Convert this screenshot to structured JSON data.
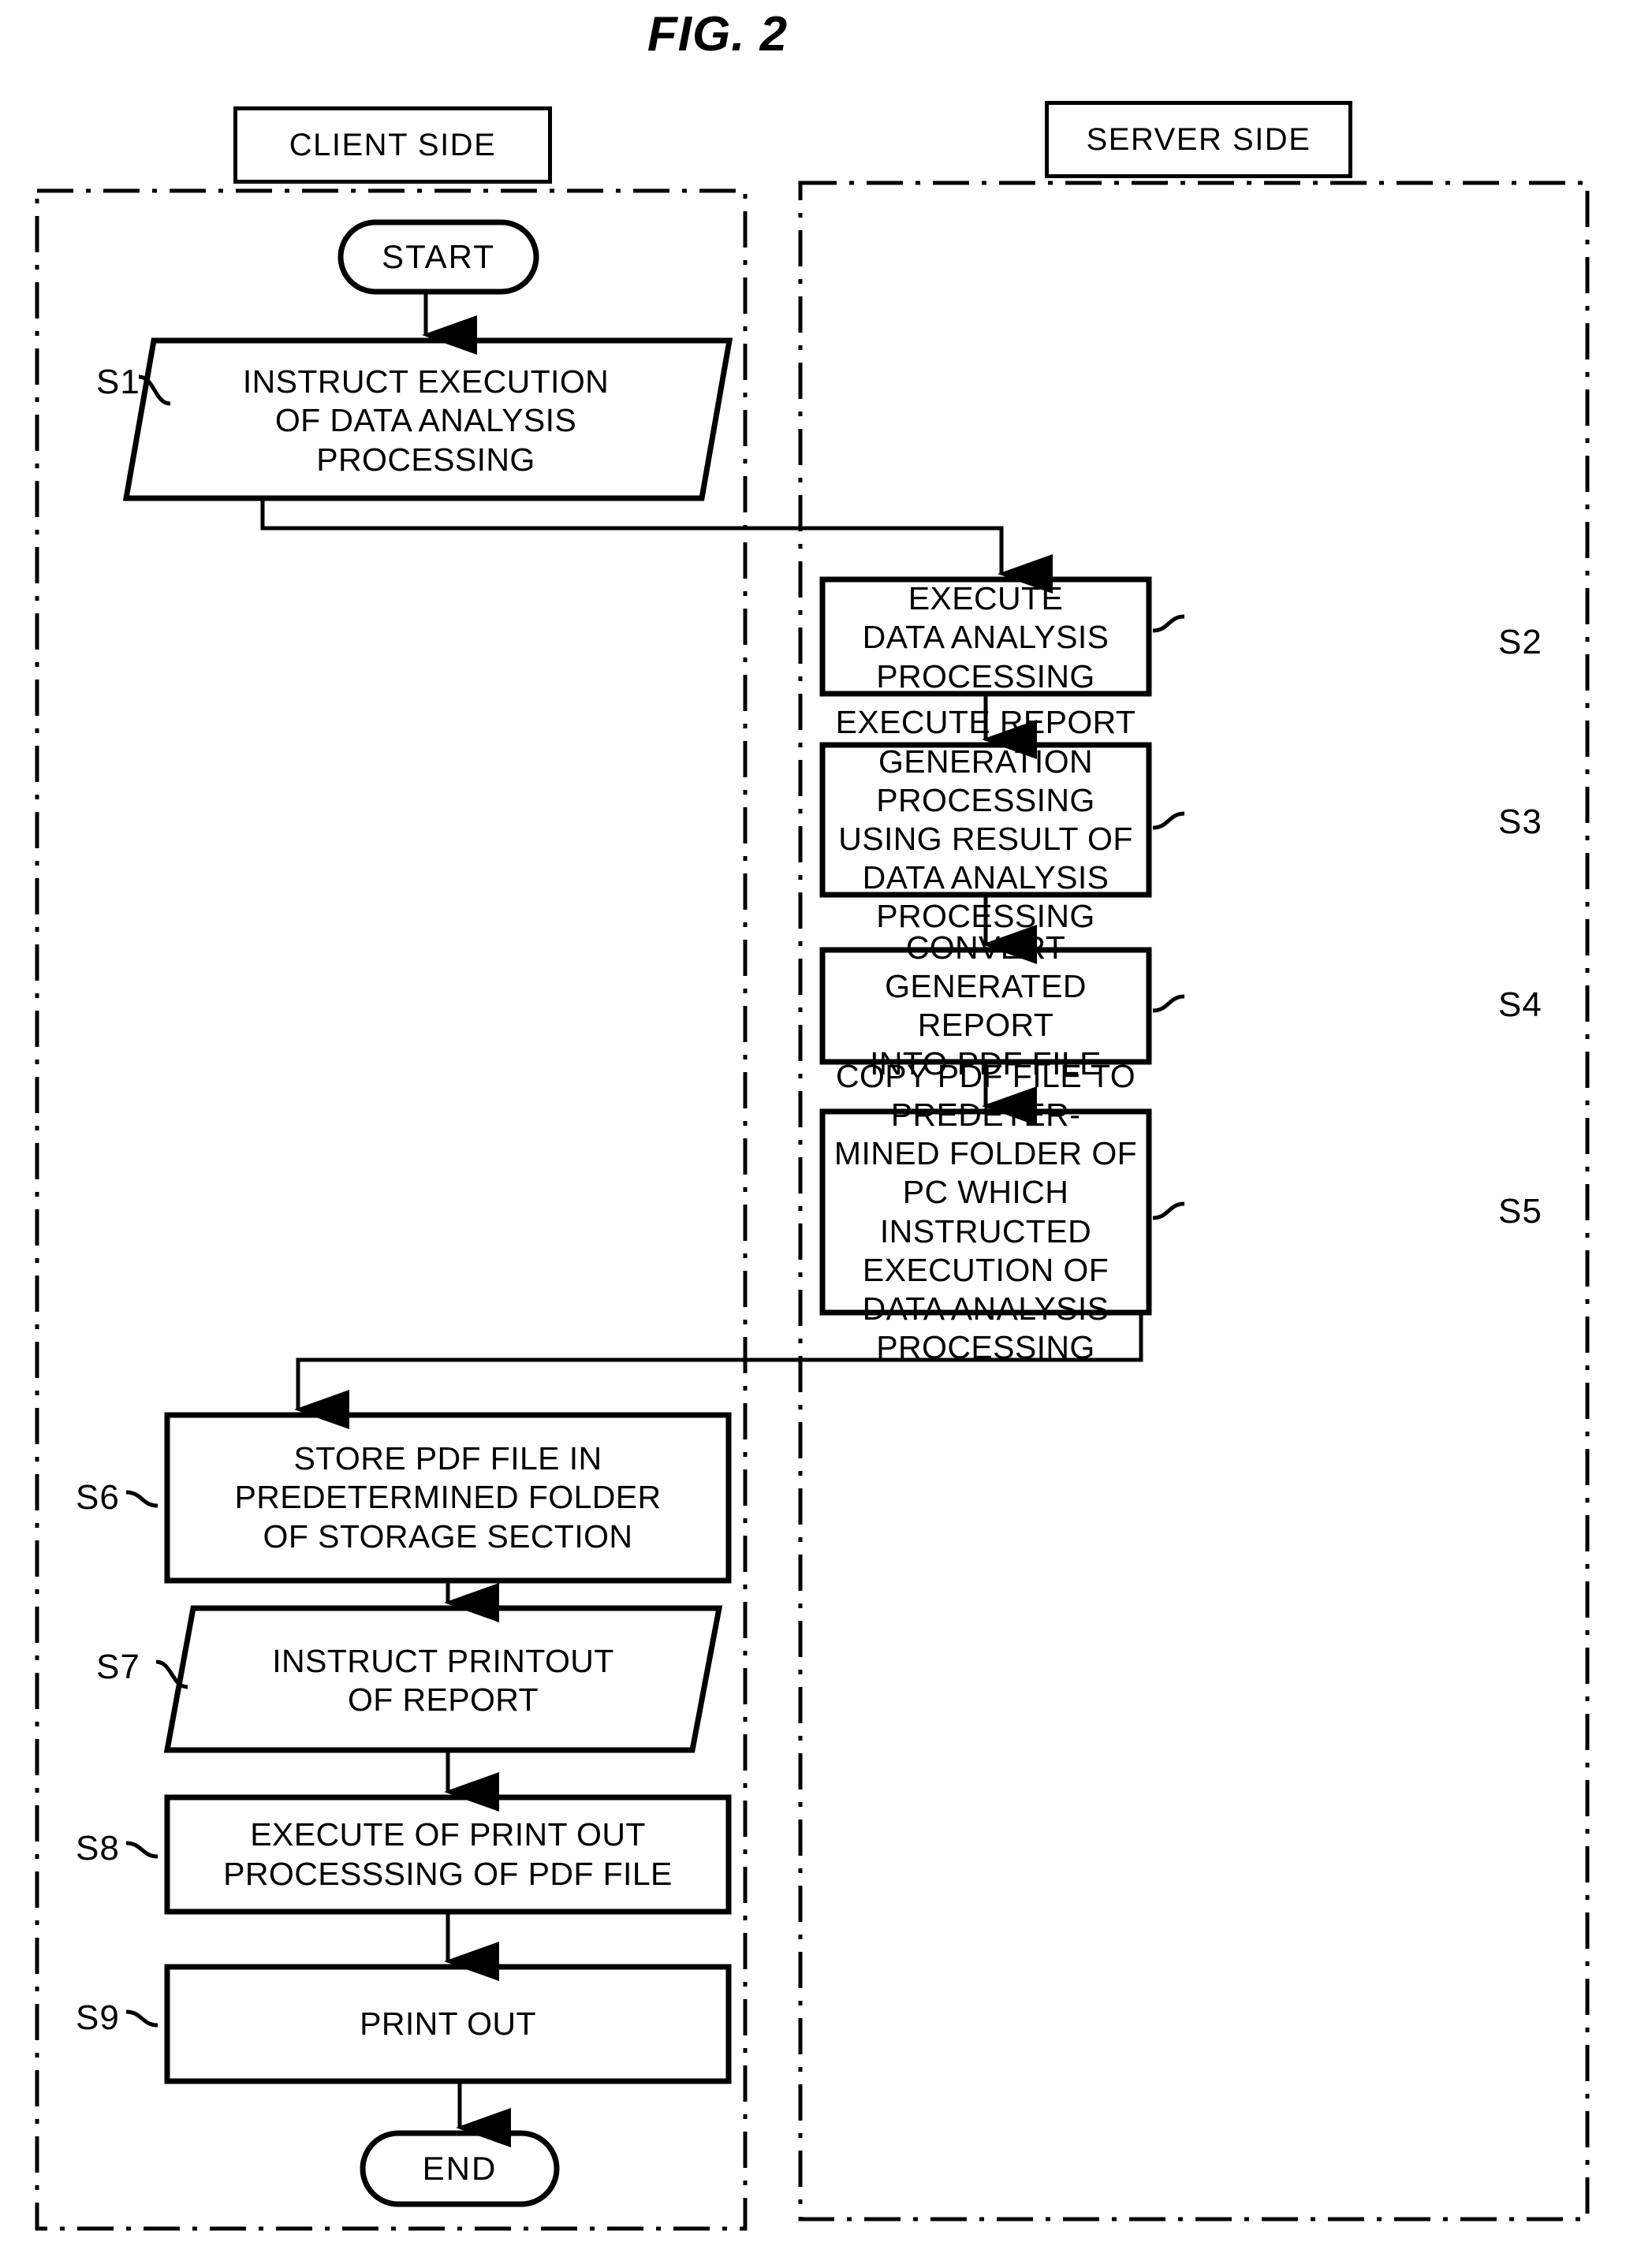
{
  "figure": {
    "title": "FIG. 2"
  },
  "lanes": [
    {
      "id": "client",
      "label": "CLIENT SIDE"
    },
    {
      "id": "server",
      "label": "SERVER SIDE"
    }
  ],
  "terminals": {
    "start": "START",
    "end": "END"
  },
  "steps": [
    {
      "id": "S1",
      "label": "S1",
      "shape": "parallelogram",
      "lane": "client",
      "lines": [
        "INSTRUCT EXECUTION",
        "OF DATA ANALYSIS",
        "PROCESSING"
      ]
    },
    {
      "id": "S2",
      "label": "S2",
      "shape": "rectangle",
      "lane": "server",
      "lines": [
        "EXECUTE",
        "DATA ANALYSIS PROCESSING"
      ]
    },
    {
      "id": "S3",
      "label": "S3",
      "shape": "rectangle",
      "lane": "server",
      "lines": [
        "EXECUTE REPORT GENERATION",
        "PROCESSING USING RESULT OF",
        "DATA ANALYSIS PROCESSING"
      ]
    },
    {
      "id": "S4",
      "label": "S4",
      "shape": "rectangle",
      "lane": "server",
      "lines": [
        "CONVERT GENERATED REPORT",
        "INTO PDF FILE"
      ]
    },
    {
      "id": "S5",
      "label": "S5",
      "shape": "rectangle",
      "lane": "server",
      "lines": [
        "COPY PDF FILE TO PREDETER-",
        "MINED FOLDER OF PC WHICH",
        "INSTRUCTED EXECUTION OF",
        "DATA ANALYSIS PROCESSING"
      ]
    },
    {
      "id": "S6",
      "label": "S6",
      "shape": "rectangle",
      "lane": "client",
      "lines": [
        "STORE PDF FILE IN",
        "PREDETERMINED FOLDER",
        "OF STORAGE SECTION"
      ]
    },
    {
      "id": "S7",
      "label": "S7",
      "shape": "parallelogram",
      "lane": "client",
      "lines": [
        "INSTRUCT PRINTOUT",
        "OF REPORT"
      ]
    },
    {
      "id": "S8",
      "label": "S8",
      "shape": "rectangle",
      "lane": "client",
      "lines": [
        "EXECUTE OF PRINT OUT",
        "PROCESSSING OF PDF FILE"
      ]
    },
    {
      "id": "S9",
      "label": "S9",
      "shape": "rectangle",
      "lane": "client",
      "lines": [
        "PRINT OUT"
      ]
    }
  ],
  "flow": [
    {
      "from": "START",
      "to": "S1"
    },
    {
      "from": "S1",
      "to": "S2"
    },
    {
      "from": "S2",
      "to": "S3"
    },
    {
      "from": "S3",
      "to": "S4"
    },
    {
      "from": "S4",
      "to": "S5"
    },
    {
      "from": "S5",
      "to": "S6"
    },
    {
      "from": "S6",
      "to": "S7"
    },
    {
      "from": "S7",
      "to": "S8"
    },
    {
      "from": "S8",
      "to": "S9"
    },
    {
      "from": "S9",
      "to": "END"
    }
  ],
  "colors": {
    "ink": "#000000",
    "paper": "#ffffff"
  }
}
